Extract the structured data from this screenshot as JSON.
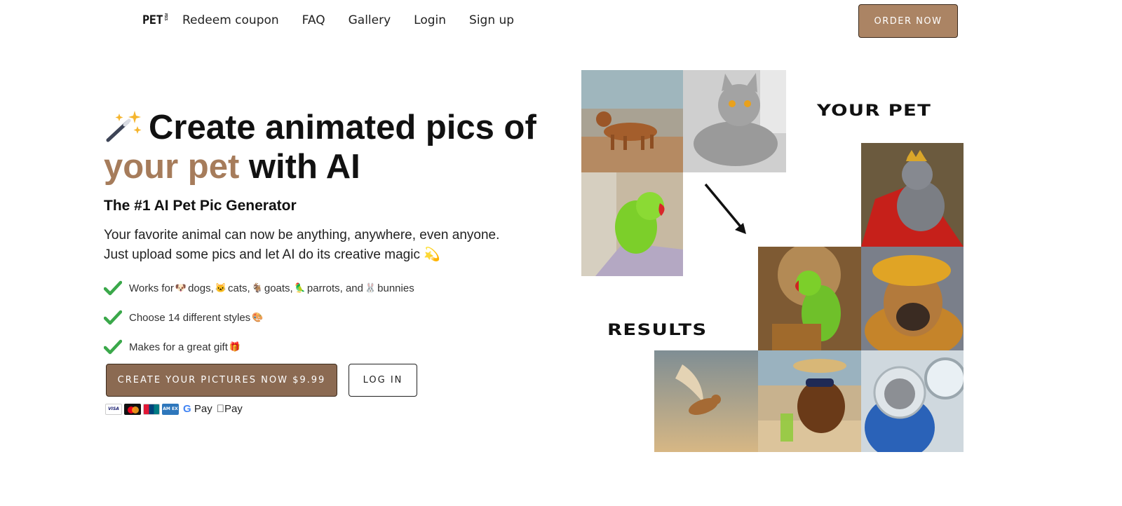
{
  "nav": {
    "logo": "PET",
    "logo_sub": "PICS",
    "links": [
      "Redeem coupon",
      "FAQ",
      "Gallery",
      "Login",
      "Sign up"
    ],
    "order_button": "ORDER NOW"
  },
  "hero": {
    "title_part1": "Create animated pics of",
    "title_accent": "your pet",
    "title_part2": "with AI",
    "subtitle": "The #1 AI Pet Pic Generator",
    "description": "Your favorite animal can now be anything, anywhere, even anyone. Just upload some pics and let AI do its creative magic 💫",
    "features": [
      {
        "text_segments": [
          "Works for",
          "🐶",
          "dogs,",
          "🐱",
          "cats,",
          "🐐",
          "goats,",
          "🦜",
          "parrots, and",
          "🐰",
          "bunnies"
        ]
      },
      {
        "text": "Choose 14 different styles",
        "emoji": "🎨"
      },
      {
        "text": "Makes for a great gift",
        "emoji": "🎁"
      }
    ],
    "cta_button": "CREATE YOUR PICTURES NOW $9.99",
    "login_button": "LOG IN",
    "payments": {
      "visa": "VISA",
      "amex": "AM EX",
      "gpay": "Pay",
      "apple": "Pay"
    }
  },
  "collage": {
    "label_your_pet": "YOUR PET",
    "label_results": "RESULTS"
  }
}
